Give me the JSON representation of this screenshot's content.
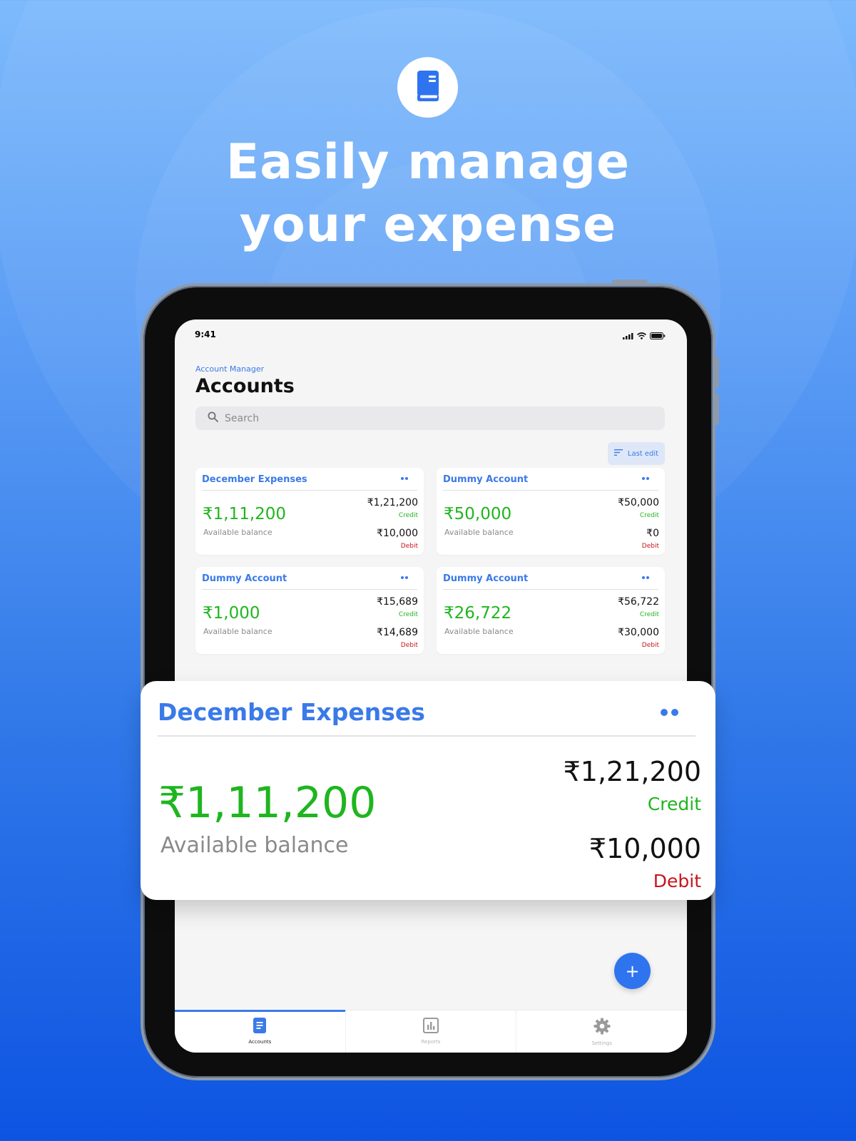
{
  "hero": {
    "line1": "Easily manage",
    "line2": "your expense",
    "icon": "book-icon"
  },
  "status_bar": {
    "time": "9:41",
    "icons": [
      "signal-icon",
      "wifi-icon",
      "battery-icon"
    ]
  },
  "header": {
    "breadcrumb": "Account Manager",
    "title": "Accounts"
  },
  "search": {
    "placeholder": "Search",
    "value": ""
  },
  "sort": {
    "label": "Last edit",
    "icon": "sort-icon"
  },
  "accounts": [
    {
      "name": "December Expenses",
      "balance": "₹1,11,200",
      "balance_label": "Available balance",
      "credit": "₹1,21,200",
      "credit_label": "Credit",
      "debit": "₹10,000",
      "debit_label": "Debit"
    },
    {
      "name": "Dummy Account",
      "balance": "₹50,000",
      "balance_label": "Available balance",
      "credit": "₹50,000",
      "credit_label": "Credit",
      "debit": "₹0",
      "debit_label": "Debit"
    },
    {
      "name": "Dummy Account",
      "balance": "₹1,000",
      "balance_label": "Available balance",
      "credit": "₹15,689",
      "credit_label": "Credit",
      "debit": "₹14,689",
      "debit_label": "Debit"
    },
    {
      "name": "Dummy Account",
      "balance": "₹26,722",
      "balance_label": "Available balance",
      "credit": "₹56,722",
      "credit_label": "Credit",
      "debit": "₹30,000",
      "debit_label": "Debit"
    }
  ],
  "featured": {
    "name": "December Expenses",
    "balance": "₹1,11,200",
    "balance_label": "Available balance",
    "credit": "₹1,21,200",
    "credit_label": "Credit",
    "debit": "₹10,000",
    "debit_label": "Debit"
  },
  "fab": {
    "label": "+"
  },
  "tabs": [
    {
      "label": "Accounts",
      "icon": "document-icon",
      "active": true
    },
    {
      "label": "Reports",
      "icon": "chart-icon",
      "active": false
    },
    {
      "label": "Settings",
      "icon": "gear-icon",
      "active": false
    }
  ],
  "colors": {
    "accent": "#3a7ae8",
    "credit": "#1fb51f",
    "debit": "#c8141c",
    "fab": "#2f74ef"
  }
}
